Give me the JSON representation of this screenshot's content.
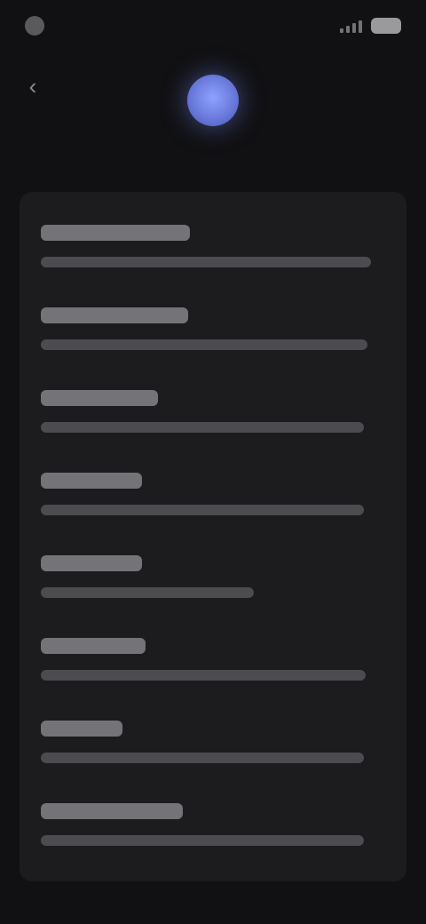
{
  "status_bar": {
    "time": "",
    "battery_icon": "battery-icon",
    "signal_icon": "signal-icon"
  },
  "nav": {
    "back_icon": "back-arrow-icon"
  },
  "profile": {
    "avatar_color": "#7486f0",
    "avatar_initials": "",
    "name": ""
  },
  "settings": {
    "items": [
      {
        "title": "",
        "description": ""
      },
      {
        "title": "",
        "description": ""
      },
      {
        "title": "",
        "description": ""
      },
      {
        "title": "",
        "description": ""
      },
      {
        "title": "",
        "description": ""
      },
      {
        "title": "",
        "description": ""
      },
      {
        "title": "",
        "description": ""
      },
      {
        "title": "",
        "description": ""
      }
    ]
  },
  "colors": {
    "background": "#111113",
    "card": "#1c1c1e",
    "accent": "#7486f0"
  }
}
